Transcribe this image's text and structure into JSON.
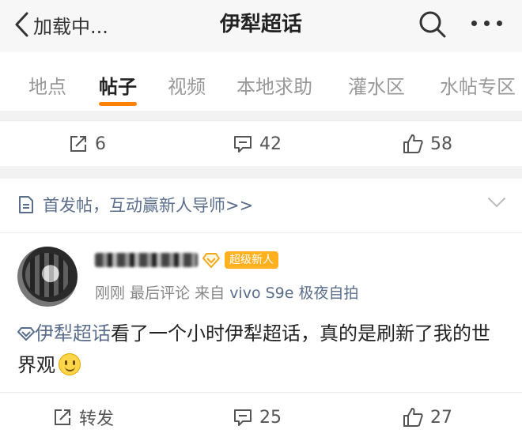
{
  "header": {
    "back_label": "加载中...",
    "title": "伊犁超话"
  },
  "tabs": [
    {
      "label": "地点",
      "active": false
    },
    {
      "label": "帖子",
      "active": true
    },
    {
      "label": "视频",
      "active": false
    },
    {
      "label": "本地求助",
      "active": false
    },
    {
      "label": "灌水区",
      "active": false
    },
    {
      "label": "水帖专区",
      "active": false
    }
  ],
  "prev_post_actions": {
    "repost": "6",
    "comment": "42",
    "like": "58"
  },
  "notice": {
    "text": "首发帖，互动赢新人导师>>"
  },
  "post": {
    "badge": "超级新人",
    "time": "刚刚",
    "last_comment": "最后评论",
    "from": "来自",
    "device": "vivo S9e 极夜自拍",
    "topic": "伊犁超话",
    "text": "看了一个小时伊犁超话，真的是刷新了我的世界观",
    "actions": {
      "repost": "转发",
      "comment": "25",
      "like": "27"
    }
  },
  "colors": {
    "accent_orange": "#ff8200",
    "link_blue": "#5a6e8c",
    "badge_yellow": "#ffb01f"
  }
}
